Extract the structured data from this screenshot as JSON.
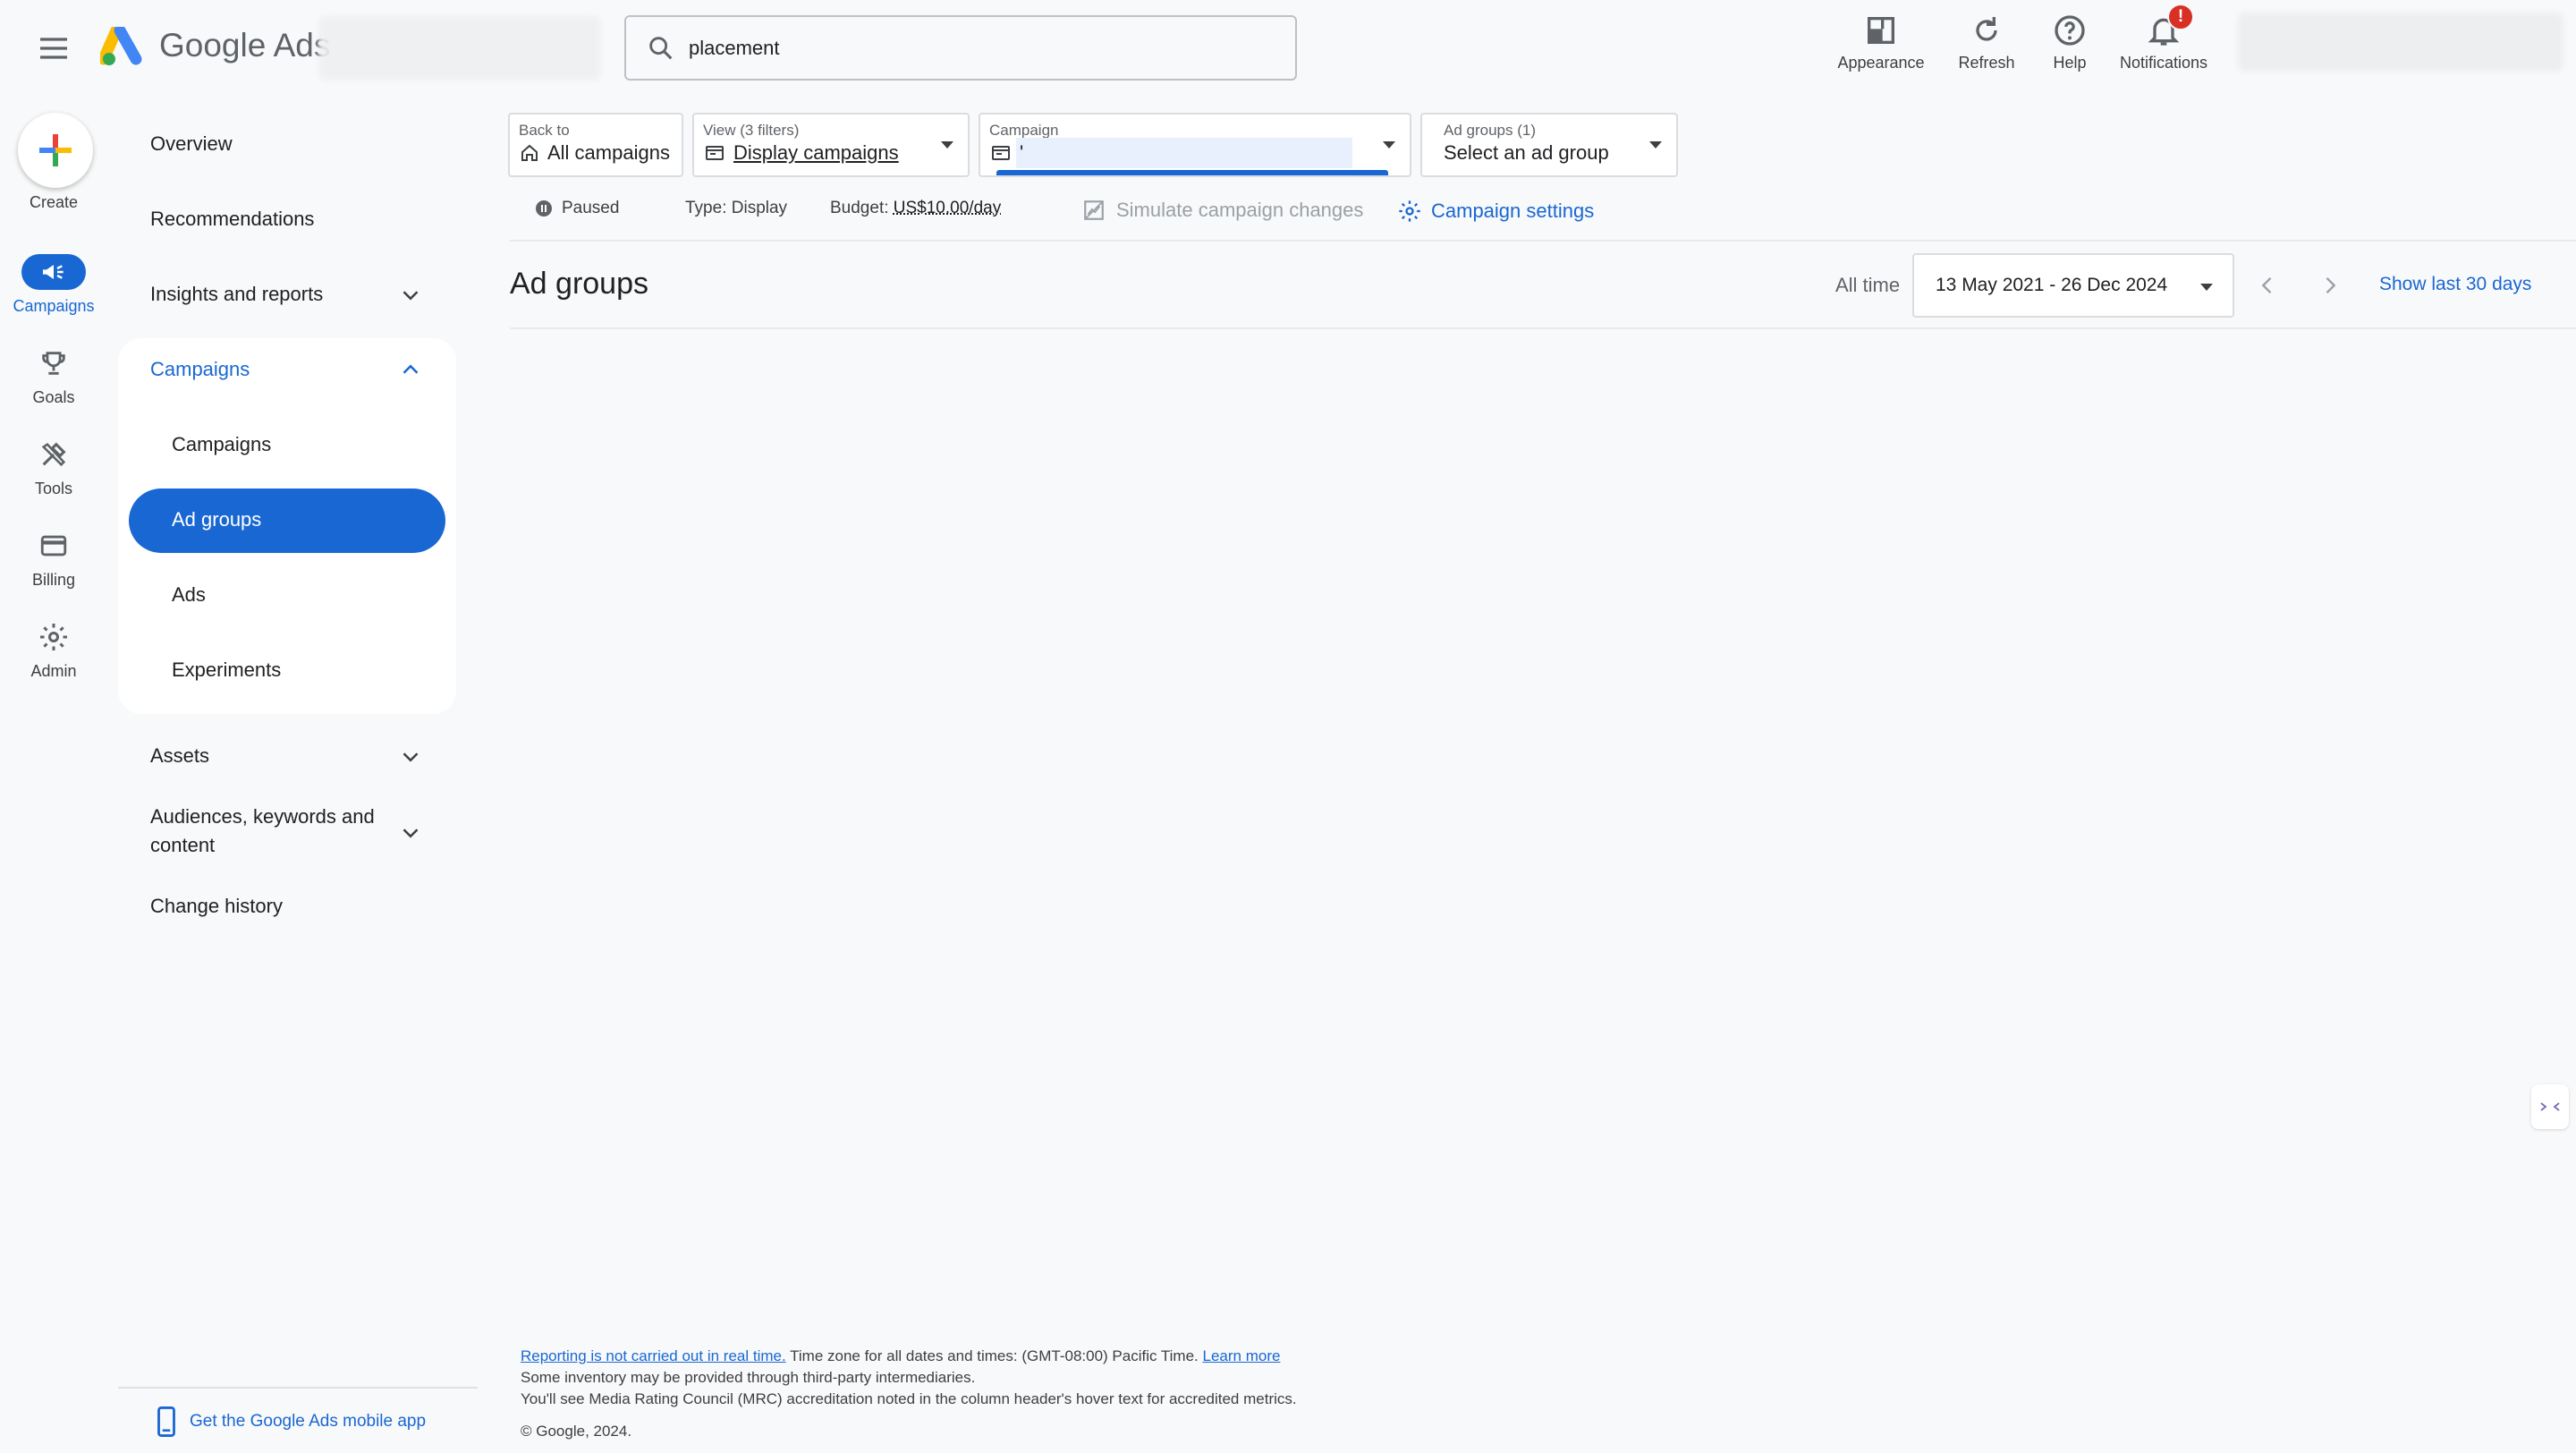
{
  "header": {
    "brand_google": "Google",
    "brand_ads": "Ads",
    "search_value": "placement",
    "buttons": {
      "appearance": "Appearance",
      "refresh": "Refresh",
      "help": "Help",
      "notifications": "Notifications",
      "notifications_badge": "!"
    }
  },
  "rail": {
    "create": "Create",
    "campaigns": "Campaigns",
    "goals": "Goals",
    "tools": "Tools",
    "billing": "Billing",
    "admin": "Admin"
  },
  "nav": {
    "overview": "Overview",
    "recommendations": "Recommendations",
    "insights": "Insights and reports",
    "campaigns_group": "Campaigns",
    "sub": [
      "Campaigns",
      "Ad groups",
      "Ads",
      "Experiments"
    ],
    "assets": "Assets",
    "audiences_line1": "Audiences, keywords and",
    "audiences_line2": "content",
    "change_history": "Change history",
    "mobile_app": "Get the Google Ads mobile app"
  },
  "filters": {
    "back_small": "Back to",
    "back_big": "All campaigns",
    "view_small": "View (3 filters)",
    "view_big": "Display campaigns",
    "campaign_small": "Campaign",
    "campaign_big": "'",
    "adgroups_small": "Ad groups (1)",
    "adgroups_big": "Select an ad group"
  },
  "status": {
    "state": "Paused",
    "type": "Type: Display",
    "budget_label": "Budget:",
    "budget_value": "US$10.00/day",
    "simulate": "Simulate campaign changes",
    "settings": "Campaign settings"
  },
  "main": {
    "title": "Ad groups",
    "all_time": "All time",
    "date_range": "13 May 2021 - 26 Dec 2024",
    "show_last": "Show last 30 days"
  },
  "footer": {
    "reporting_link": "Reporting is not carried out in real time.",
    "timezone": "Time zone for all dates and times: (GMT-08:00) Pacific Time.",
    "learn_more": "Learn more",
    "inventory": "Some inventory may be provided through third-party intermediaries.",
    "mrc": "You'll see Media Rating Council (MRC) accreditation noted in the column header's hover text for accredited metrics.",
    "copyright": "© Google, 2024."
  },
  "colors": {
    "accent": "#1967d2",
    "badge": "#d93025",
    "background": "#f8f9fa"
  }
}
